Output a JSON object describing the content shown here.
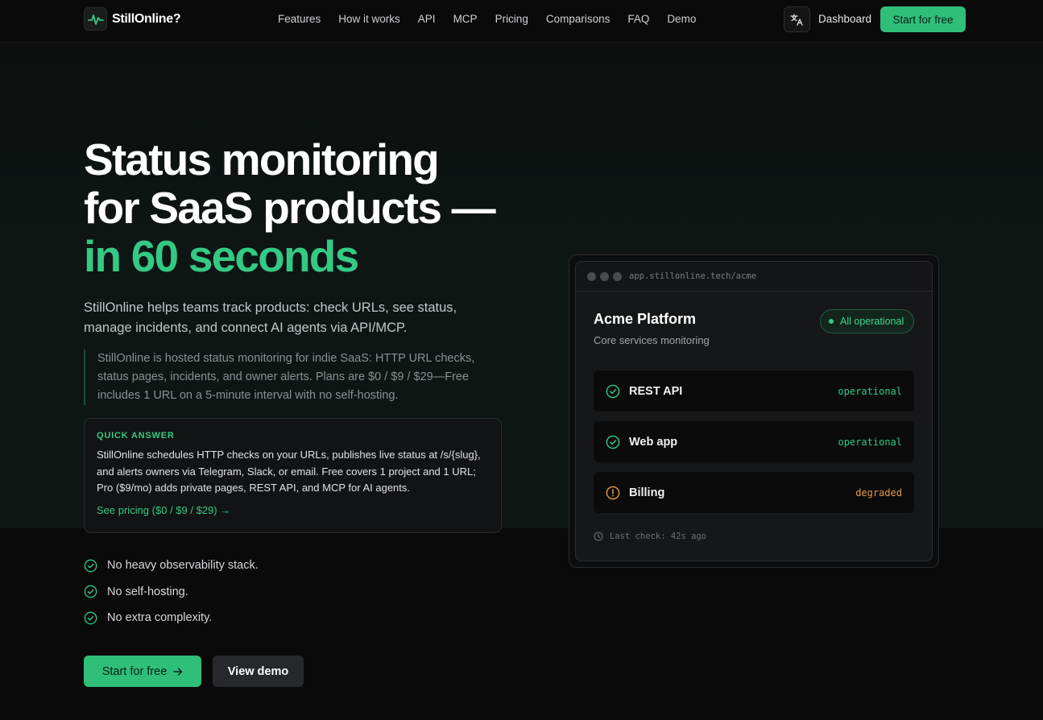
{
  "nav": {
    "brand": "StillOnline?",
    "links": [
      "Features",
      "How it works",
      "API",
      "MCP",
      "Pricing",
      "Comparisons",
      "FAQ",
      "Demo"
    ],
    "dashboard": "Dashboard",
    "cta": "Start for free"
  },
  "hero": {
    "title_line1": "Status monitoring",
    "title_line2": "for SaaS products —",
    "title_accent": "in 60 seconds",
    "lead": "StillOnline helps teams track products: check URLs, see status, manage incidents, and connect AI agents via API/MCP.",
    "quote": "StillOnline is hosted status monitoring for indie SaaS: HTTP URL checks, status pages, incidents, and owner alerts. Plans are $0 / $9 / $29—Free includes 1 URL on a 5-minute interval with no self-hosting.",
    "quick_answer": {
      "label": "QUICK ANSWER",
      "body": "StillOnline schedules HTTP checks on your URLs, publishes live status at /s/{slug}, and alerts owners via Telegram, Slack, or email. Free covers 1 project and 1 URL; Pro ($9/mo) adds private pages, REST API, and MCP for AI agents.",
      "link": "See pricing ($0 / $9 / $29) →"
    },
    "checks": [
      "No heavy observability stack.",
      "No self-hosting.",
      "No extra complexity."
    ],
    "primary_button": "Start for free",
    "secondary_button": "View demo"
  },
  "demo": {
    "url": "app.stillonline.tech/acme",
    "title": "Acme Platform",
    "subtitle": "Core services monitoring",
    "badge": "All operational",
    "services": [
      {
        "name": "REST API",
        "state": "operational",
        "icon": "check-circle-icon"
      },
      {
        "name": "Web app",
        "state": "operational",
        "icon": "check-circle-icon"
      },
      {
        "name": "Billing",
        "state": "degraded",
        "icon": "alert-circle-icon"
      }
    ],
    "last_check": "Last check: 42s ago"
  },
  "colors": {
    "accent": "#34c984",
    "button": "#2fbf78",
    "warning": "#e59a3c",
    "background": "#0a0a0b"
  }
}
